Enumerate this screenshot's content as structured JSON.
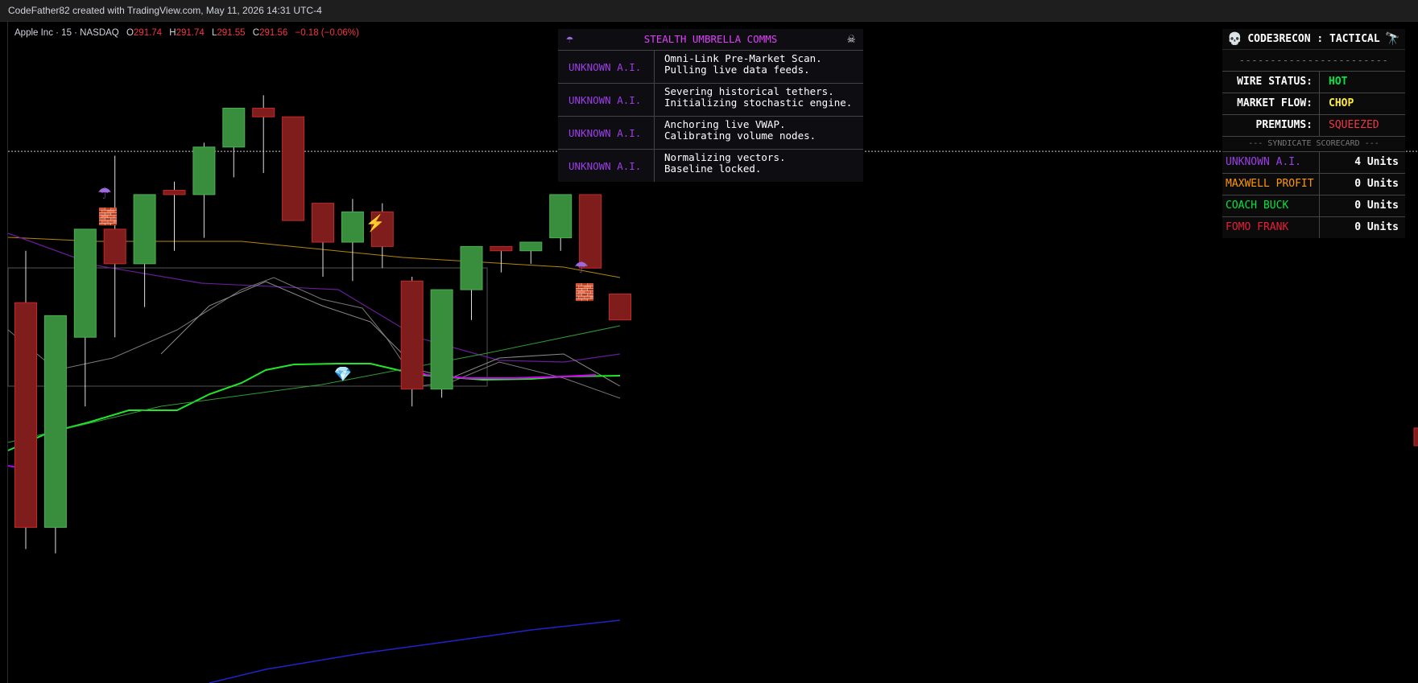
{
  "header": {
    "text": "CodeFather82 created with TradingView.com, May 11, 2026 14:31 UTC-4"
  },
  "legend": {
    "symbol": "Apple Inc · 15 · NASDAQ",
    "open_label": "O",
    "open": "291.74",
    "high_label": "H",
    "high": "291.74",
    "low_label": "L",
    "low": "291.55",
    "close_label": "C",
    "close": "291.56",
    "change": "−0.18 (−0.06%)"
  },
  "comms": {
    "left_icon": "umbrella-icon",
    "left_glyph": "☂",
    "title": "STEALTH UMBRELLA COMMS",
    "right_icon": "skull-crossbones-icon",
    "right_glyph": "☠",
    "rows": [
      {
        "who": "UNKNOWN A.I.",
        "line1": "Omni-Link Pre-Market Scan.",
        "line2": "Pulling live data feeds."
      },
      {
        "who": "UNKNOWN A.I.",
        "line1": "Severing historical tethers.",
        "line2": "Initializing stochastic engine."
      },
      {
        "who": "UNKNOWN A.I.",
        "line1": "Anchoring live VWAP.",
        "line2": "Calibrating volume nodes."
      },
      {
        "who": "UNKNOWN A.I.",
        "line1": "Normalizing vectors.",
        "line2": "Baseline locked."
      }
    ]
  },
  "tactical": {
    "left_icon": "skull-icon",
    "left_glyph": "💀",
    "title": "CODE3RECON : TACTICAL",
    "right_icon": "telescope-icon",
    "right_glyph": "🔭",
    "separator": "------------------------",
    "status": [
      {
        "label": "WIRE STATUS:",
        "value": "HOT",
        "color": "#00e640"
      },
      {
        "label": "MARKET FLOW:",
        "value": "CHOP",
        "color": "#ffeb3b"
      },
      {
        "label": "PREMIUMS:",
        "value": "SQUEEZED",
        "color": "#f23645"
      }
    ],
    "scorecard_title": "--- SYNDICATE SCORECARD ---",
    "scorecard": [
      {
        "name": "UNKNOWN A.I.",
        "units": "4 Units",
        "color": "#9c3ee6"
      },
      {
        "name": "MAXWELL PROFIT",
        "units": "0 Units",
        "color": "#ff9800"
      },
      {
        "name": "COACH BUCK",
        "units": "0 Units",
        "color": "#00e640"
      },
      {
        "name": "FOMO FRANK",
        "units": "0 Units",
        "color": "#e91e3a"
      }
    ]
  },
  "chart_data": {
    "type": "candlestick",
    "up_color": "#388e3c",
    "down_color": "#7f1d1d",
    "candles": [
      {
        "o": 291.45,
        "h": 291.57,
        "l": 290.88,
        "c": 290.93
      },
      {
        "o": 290.93,
        "h": 291.42,
        "l": 290.87,
        "c": 291.42
      },
      {
        "o": 291.37,
        "h": 291.49,
        "l": 291.21,
        "c": 291.62
      },
      {
        "o": 291.62,
        "h": 291.79,
        "l": 291.37,
        "c": 291.54
      },
      {
        "o": 291.54,
        "h": 291.7,
        "l": 291.44,
        "c": 291.7
      },
      {
        "o": 291.71,
        "h": 291.73,
        "l": 291.57,
        "c": 291.7
      },
      {
        "o": 291.7,
        "h": 291.82,
        "l": 291.6,
        "c": 291.81
      },
      {
        "o": 291.81,
        "h": 291.87,
        "l": 291.74,
        "c": 291.9
      },
      {
        "o": 291.9,
        "h": 291.93,
        "l": 291.75,
        "c": 291.88
      },
      {
        "o": 291.88,
        "h": 291.86,
        "l": 291.71,
        "c": 291.64
      },
      {
        "o": 291.68,
        "h": 291.68,
        "l": 291.51,
        "c": 291.59
      },
      {
        "o": 291.59,
        "h": 291.69,
        "l": 291.5,
        "c": 291.66
      },
      {
        "o": 291.66,
        "h": 291.68,
        "l": 291.53,
        "c": 291.58
      },
      {
        "o": 291.5,
        "h": 291.51,
        "l": 291.21,
        "c": 291.25
      },
      {
        "o": 291.25,
        "h": 291.44,
        "l": 291.23,
        "c": 291.48
      },
      {
        "o": 291.48,
        "h": 291.55,
        "l": 291.41,
        "c": 291.58
      },
      {
        "o": 291.58,
        "h": 291.57,
        "l": 291.52,
        "c": 291.57
      },
      {
        "o": 291.57,
        "h": 291.59,
        "l": 291.54,
        "c": 291.59
      },
      {
        "o": 291.6,
        "h": 291.68,
        "l": 291.57,
        "c": 291.7
      },
      {
        "o": 291.7,
        "h": 291.69,
        "l": 291.55,
        "c": 291.53
      },
      {
        "o": 291.47,
        "h": 291.47,
        "l": 291.41,
        "c": 291.41
      }
    ],
    "current_price": 291.8,
    "ylim": [
      290.57,
      292.1
    ]
  }
}
